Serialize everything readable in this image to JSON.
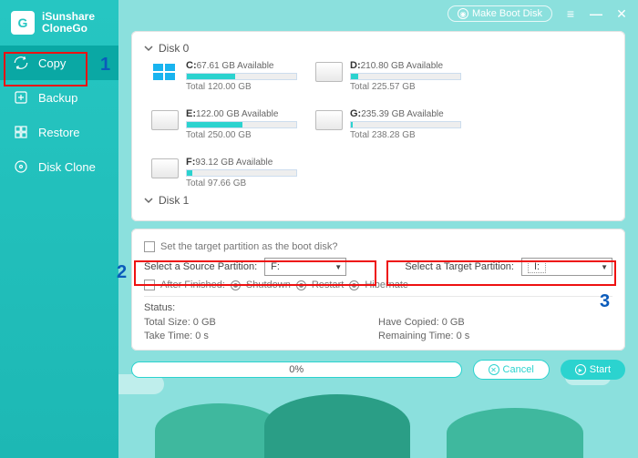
{
  "app": {
    "name1": "iSunshare",
    "name2": "CloneGo"
  },
  "titlebar": {
    "make_boot": "Make Boot Disk"
  },
  "sidebar": {
    "items": [
      {
        "label": "Copy"
      },
      {
        "label": "Backup"
      },
      {
        "label": "Restore"
      },
      {
        "label": "Disk Clone"
      }
    ]
  },
  "disks": {
    "disk0_label": "Disk 0",
    "disk1_label": "Disk 1",
    "disk0": [
      {
        "letter": "C:",
        "avail": "67.61 GB Available",
        "total": "Total 120.00 GB",
        "pct": 44,
        "win": true
      },
      {
        "letter": "D:",
        "avail": "210.80 GB Available",
        "total": "Total 225.57 GB",
        "pct": 7
      },
      {
        "letter": "E:",
        "avail": "122.00 GB Available",
        "total": "Total 250.00 GB",
        "pct": 51
      },
      {
        "letter": "G:",
        "avail": "235.39 GB Available",
        "total": "Total 238.28 GB",
        "pct": 2
      },
      {
        "letter": "F:",
        "avail": "93.12 GB Available",
        "total": "Total 97.66 GB",
        "pct": 5
      }
    ]
  },
  "options": {
    "boot_label": "Set the target partition as the boot disk?",
    "source_label": "Select a Source Partition:",
    "source_value": "F:",
    "target_label": "Select a Target Partition:",
    "target_value": "I:",
    "after_label": "After Finished:",
    "shutdown": "Shutdown",
    "restart": "Restart",
    "hibernate": "Hibernate"
  },
  "status": {
    "heading": "Status:",
    "total_size": "Total Size: 0 GB",
    "take_time": "Take Time: 0 s",
    "have_copied": "Have Copied: 0 GB",
    "remaining": "Remaining Time: 0 s"
  },
  "bottom": {
    "progress": "0%",
    "cancel": "Cancel",
    "start": "Start"
  },
  "annotations": {
    "a1": "1",
    "a2": "2",
    "a3": "3"
  }
}
